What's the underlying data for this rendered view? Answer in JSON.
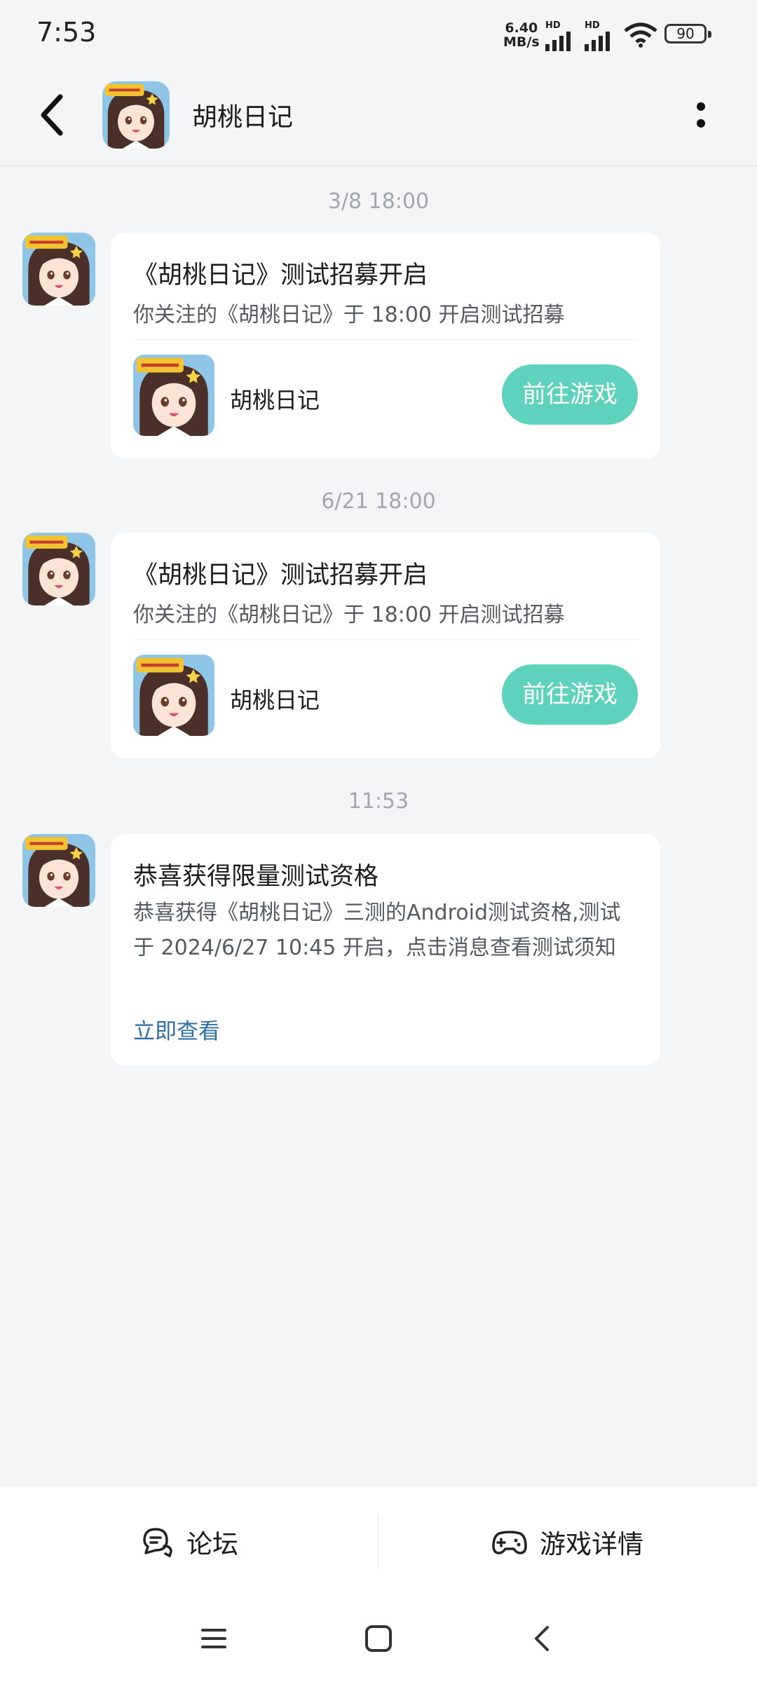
{
  "status_bar": {
    "time": "7:53",
    "net_speed_value": "6.40",
    "net_speed_unit": "MB/s",
    "hd1": "HD",
    "hd2": "HD",
    "battery": "90"
  },
  "header": {
    "title": "胡桃日记"
  },
  "messages": [
    {
      "timestamp": "3/8  18:00",
      "title": "《胡桃日记》测试招募开启",
      "description": "你关注的《胡桃日记》于 18:00 开启测试招募",
      "game_name": "胡桃日记",
      "button": "前往游戏"
    },
    {
      "timestamp": "6/21  18:00",
      "title": "《胡桃日记》测试招募开启",
      "description": "你关注的《胡桃日记》于 18:00 开启测试招募",
      "game_name": "胡桃日记",
      "button": "前往游戏"
    },
    {
      "timestamp": "11:53",
      "title": "恭喜获得限量测试资格",
      "description": "恭喜获得《胡桃日记》三测的Android测试资格,测试于 2024/6/27 10:45 开启，点击消息查看测试须知",
      "link": "立即查看"
    }
  ],
  "bottom_bar": {
    "forum": "论坛",
    "game_details": "游戏详情"
  },
  "icons": {
    "back": "chevron-left-icon",
    "more": "more-vertical-icon",
    "forum": "chat-bubbles-icon",
    "game": "gamepad-icon"
  },
  "colors": {
    "accent": "#5fd2bd",
    "link": "#2d6fa3",
    "background": "#f4f5f7"
  }
}
